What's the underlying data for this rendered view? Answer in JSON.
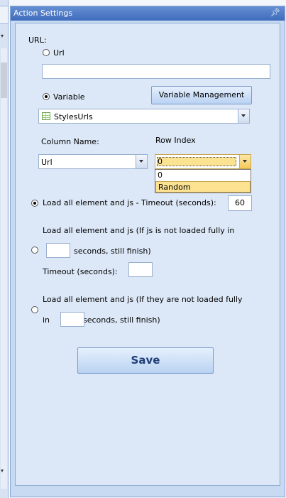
{
  "window": {
    "title": "Action Settings"
  },
  "url_section": {
    "label": "URL:",
    "url_option_label": "Url",
    "url_value": "",
    "variable_option_label": "Variable",
    "variable_management_button": "Variable Management",
    "variable_selected": "StylesUrls"
  },
  "column": {
    "label": "Column Name:",
    "value": "Url"
  },
  "row_index": {
    "label": "Row Index",
    "value": "0",
    "options": [
      "0",
      "Random"
    ],
    "highlighted": "Random"
  },
  "load_options": {
    "option1": {
      "label": "Load all element and js - Timeout (seconds):",
      "timeout": "60"
    },
    "option2": {
      "line1": "Load all element and js (If js is not loaded fully in",
      "seconds_value": "",
      "suffix": "seconds, still finish)",
      "timeout_label": "Timeout (seconds):",
      "timeout_value": ""
    },
    "option3": {
      "line1": "Load all element and js (If they are not loaded fully",
      "in_label": "in",
      "seconds_value": "",
      "suffix": "seconds, still finish)"
    }
  },
  "save_button": "Save",
  "colors": {
    "title_bar": "#3e6bbc",
    "panel_bg": "#dce8f7",
    "highlight": "#fce392"
  }
}
